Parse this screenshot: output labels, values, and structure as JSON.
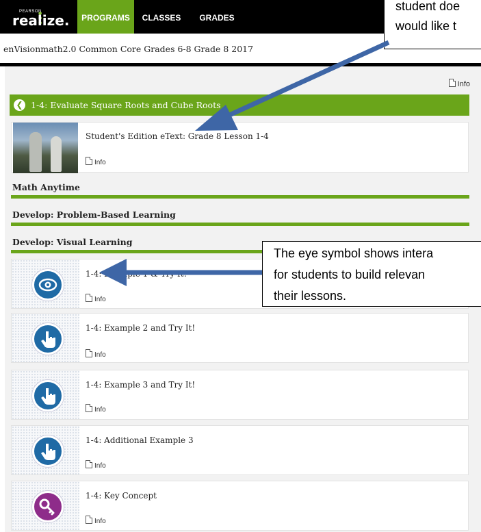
{
  "nav": {
    "logo_small": "PEARSON",
    "logo_main": "realize.",
    "tabs": [
      {
        "label": "PROGRAMS",
        "active": true
      },
      {
        "label": "CLASSES",
        "active": false
      },
      {
        "label": "GRADES",
        "active": false
      }
    ]
  },
  "breadcrumb": "enVisionmath2.0 Common Core Grades 6-8 Grade 8 2017",
  "top_info": "Info",
  "lesson": {
    "back_icon": "back-arrow-icon",
    "title": "1-4: Evaluate Square Roots and Cube Roots"
  },
  "etext": {
    "title": "Student's Edition eText: Grade 8 Lesson 1-4",
    "info": "Info"
  },
  "sections": [
    {
      "label": "Math Anytime"
    },
    {
      "label": "Develop: Problem-Based Learning"
    },
    {
      "label": "Develop: Visual Learning"
    }
  ],
  "items": [
    {
      "title": "1-4: Example 1 & Try It!",
      "info": "Info",
      "icon": "eye-icon",
      "color": "#1f6aa5"
    },
    {
      "title": "1-4: Example 2 and Try It!",
      "info": "Info",
      "icon": "hand-pointer-icon",
      "color": "#1f6aa5"
    },
    {
      "title": "1-4: Example 3 and Try It!",
      "info": "Info",
      "icon": "hand-pointer-icon",
      "color": "#1f6aa5"
    },
    {
      "title": "1-4: Additional Example 3",
      "info": "Info",
      "icon": "hand-pointer-icon",
      "color": "#1f6aa5"
    },
    {
      "title": "1-4: Key Concept",
      "info": "Info",
      "icon": "key-icon",
      "color": "#8e2c8a"
    }
  ],
  "callouts": {
    "top_lines": [
      "student doe",
      "would like t"
    ],
    "middle_lines": [
      "The eye symbol shows intera",
      "for students to build relevan",
      "their lessons."
    ]
  },
  "colors": {
    "accent_green": "#6aa51a",
    "nav_black": "#000000",
    "icon_blue": "#1f6aa5",
    "icon_purple": "#8e2c8a",
    "arrow_blue": "#3e66a6"
  }
}
